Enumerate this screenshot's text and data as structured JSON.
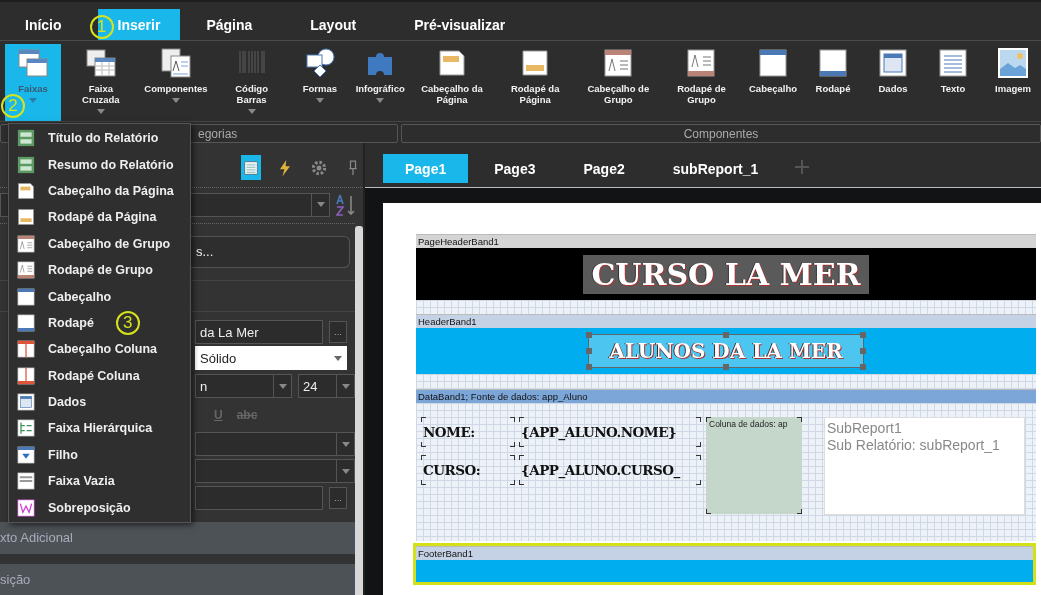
{
  "menu_tabs": [
    {
      "label": "Início",
      "selected": false
    },
    {
      "label": "Inserir",
      "selected": true,
      "callout": "1"
    },
    {
      "label": "Página",
      "selected": false
    },
    {
      "label": "Layout",
      "selected": false
    },
    {
      "label": "Pré-visualizar",
      "selected": false
    }
  ],
  "ribbon": {
    "items": [
      {
        "kind": "bands",
        "label": "Faixas",
        "selected": true,
        "dropdown": true,
        "callout": "2"
      },
      {
        "kind": "cross-band",
        "label": "Faixa Cruzada",
        "selected": false,
        "dropdown": true
      },
      {
        "kind": "components",
        "label": "Componentes",
        "selected": false,
        "dropdown": true
      },
      {
        "kind": "barcode",
        "label": "Código Barras",
        "selected": false,
        "dropdown": true,
        "disabled": true
      },
      {
        "kind": "shapes",
        "label": "Formas",
        "selected": false,
        "dropdown": true
      },
      {
        "kind": "puzzle",
        "label": "Infográfico",
        "selected": false,
        "dropdown": true
      },
      {
        "kind": "page-header",
        "label": "Cabeçalho da Página",
        "selected": false,
        "dropdown": false
      },
      {
        "kind": "page-footer",
        "label": "Rodapé da Página",
        "selected": false,
        "dropdown": false
      },
      {
        "kind": "group-header",
        "label": "Cabeçalho de Grupo",
        "selected": false,
        "dropdown": false
      },
      {
        "kind": "group-footer",
        "label": "Rodapé de Grupo",
        "selected": false,
        "dropdown": false
      },
      {
        "kind": "header",
        "label": "Cabeçalho",
        "selected": false,
        "dropdown": false
      },
      {
        "kind": "footer",
        "label": "Rodapé",
        "selected": false,
        "dropdown": false
      },
      {
        "kind": "data",
        "label": "Dados",
        "selected": false,
        "dropdown": false
      },
      {
        "kind": "text",
        "label": "Texto",
        "selected": false,
        "dropdown": false
      },
      {
        "kind": "image",
        "label": "Imagem",
        "selected": false,
        "dropdown": false
      }
    ],
    "groups": [
      "egorias",
      "Componentes"
    ]
  },
  "bands_menu": [
    {
      "kind": "report-title",
      "label": "Título do Relatório"
    },
    {
      "kind": "report-summary",
      "label": "Resumo do Relatório"
    },
    {
      "kind": "page-header",
      "label": "Cabeçalho da Página"
    },
    {
      "kind": "page-footer",
      "label": "Rodapé da Página"
    },
    {
      "kind": "group-header",
      "label": "Cabeçalho de Grupo"
    },
    {
      "kind": "group-footer",
      "label": "Rodapé de Grupo"
    },
    {
      "kind": "header",
      "label": "Cabeçalho"
    },
    {
      "kind": "footer",
      "label": "Rodapé",
      "callout": "3"
    },
    {
      "kind": "column-header",
      "label": "Cabeçalho Coluna"
    },
    {
      "kind": "column-footer",
      "label": "Rodapé Coluna"
    },
    {
      "kind": "data",
      "label": "Dados"
    },
    {
      "kind": "hierarchy",
      "label": "Faixa Hierárquica"
    },
    {
      "kind": "child",
      "label": "Filho"
    },
    {
      "kind": "empty",
      "label": "Faixa Vazia"
    },
    {
      "kind": "overlay",
      "label": "Sobreposição"
    }
  ],
  "properties": {
    "tools": [
      {
        "kind": "list",
        "selected": true
      },
      {
        "kind": "events",
        "selected": false
      },
      {
        "kind": "settings",
        "selected": false
      },
      {
        "kind": "pin",
        "selected": false
      }
    ],
    "edit_button": "s...",
    "text_field": {
      "value": "da La Mer",
      "button": "..."
    },
    "border_select": "Sólido",
    "font_select": "n",
    "size_select": "24",
    "styles": [
      "U",
      "abc"
    ],
    "last_field_button": "...",
    "sections": [
      "xto Adicional",
      "sição"
    ]
  },
  "page_tabs": [
    {
      "label": "Page1",
      "selected": true
    },
    {
      "label": "Page3",
      "selected": false
    },
    {
      "label": "Page2",
      "selected": false
    },
    {
      "label": "subReport_1",
      "selected": false
    }
  ],
  "bands": [
    {
      "kind": "page-header",
      "label": "PageHeaderBand1",
      "title": "CURSO LA MER"
    },
    {
      "kind": "header",
      "label": "HeaderBand1",
      "title": "ALUNOS DA LA MER",
      "selected": true
    },
    {
      "kind": "data",
      "label": "DataBand1; Fonte de dados: app_Aluno",
      "fields": [
        {
          "label": "NOME:",
          "value": "{APP_ALUNO.NOME}"
        },
        {
          "label": "CURSO:",
          "value": "{APP_ALUNO.CURSO_"
        }
      ],
      "column": "Coluna de dados: ap",
      "subreport": [
        "SubReport1",
        "Sub Relatório: subReport_1"
      ]
    },
    {
      "kind": "footer",
      "label": "FooterBand1",
      "highlighted": true
    }
  ]
}
